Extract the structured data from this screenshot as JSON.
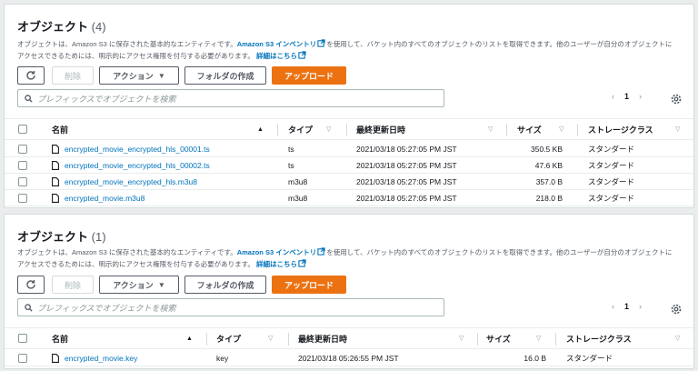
{
  "desc_part1": "オブジェクトは、Amazon S3 に保存された基本的なエンティティです。",
  "desc_link1": "Amazon S3 インベントリ",
  "desc_part2": "を使用して、バケット内のすべてのオブジェクトのリストを取得できます。他のユーザーが自分のオブジェクトにアクセスできるためには、明示的にアクセス権限を付与する必要があります。",
  "desc_link2": "詳細はこちら",
  "buttons": {
    "delete": "削除",
    "actions": "アクション",
    "create_folder": "フォルダの作成",
    "upload": "アップロード"
  },
  "search_placeholder": "プレフィックスでオブジェクトを検索",
  "columns": {
    "name": "名前",
    "type": "タイプ",
    "modified": "最終更新日時",
    "size": "サイズ",
    "storage": "ストレージクラス"
  },
  "icons": {
    "refresh": "refresh-icon",
    "search": "search-icon",
    "external": "external-link-icon",
    "settings": "gear-icon",
    "file": "file-icon",
    "sort": "sort-triangle-icon"
  },
  "colors": {
    "primary": "#ec7211",
    "link": "#0073bb"
  },
  "panel1": {
    "title": "オブジェクト",
    "count": "(4)",
    "page": "1",
    "rows": [
      {
        "name": "encrypted_movie_encrypted_hls_00001.ts",
        "type": "ts",
        "modified": "2021/03/18 05:27:05 PM JST",
        "size": "350.5 KB",
        "storage": "スタンダード"
      },
      {
        "name": "encrypted_movie_encrypted_hls_00002.ts",
        "type": "ts",
        "modified": "2021/03/18 05:27:05 PM JST",
        "size": "47.6 KB",
        "storage": "スタンダード"
      },
      {
        "name": "encrypted_movie_encrypted_hls.m3u8",
        "type": "m3u8",
        "modified": "2021/03/18 05:27:05 PM JST",
        "size": "357.0 B",
        "storage": "スタンダード"
      },
      {
        "name": "encrypted_movie.m3u8",
        "type": "m3u8",
        "modified": "2021/03/18 05:27:05 PM JST",
        "size": "218.0 B",
        "storage": "スタンダード"
      }
    ]
  },
  "panel2": {
    "title": "オブジェクト",
    "count": "(1)",
    "page": "1",
    "rows": [
      {
        "name": "encrypted_movie.key",
        "type": "key",
        "modified": "2021/03/18 05:26:55 PM JST",
        "size": "16.0 B",
        "storage": "スタンダード"
      }
    ]
  }
}
